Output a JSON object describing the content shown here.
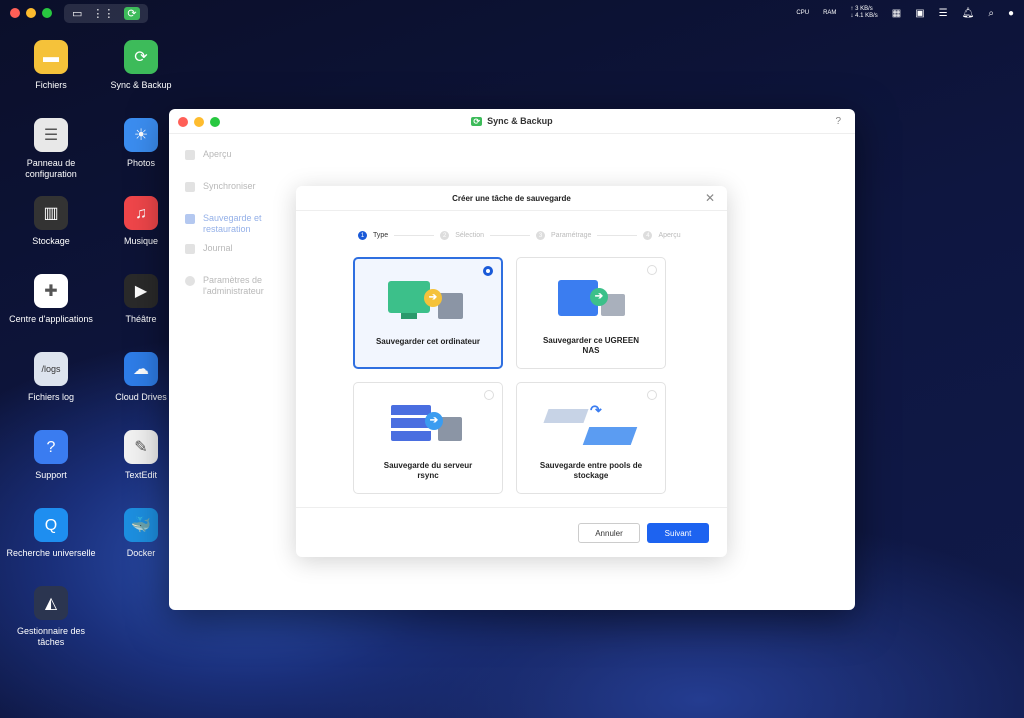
{
  "menubar": {
    "cpu": "CPU",
    "ram": "RAM",
    "upload": "↑ 3 KB/s",
    "download": "↓ 4.1 KB/s"
  },
  "desktop": [
    {
      "label": "Fichiers",
      "color": "#f5c23a",
      "glyph": "▬"
    },
    {
      "label": "Sync & Backup",
      "color": "#3dbb5a",
      "glyph": "⟳"
    },
    {
      "label": "Panneau de configuration",
      "color": "#e8e8e8",
      "glyph": "☰"
    },
    {
      "label": "Photos",
      "color": "#3b8df0",
      "glyph": "☀"
    },
    {
      "label": "Stockage",
      "color": "#333",
      "glyph": "▥"
    },
    {
      "label": "Musique",
      "color": "#f0464a",
      "glyph": "♫"
    },
    {
      "label": "Centre d'applications",
      "color": "#fff",
      "glyph": "✚"
    },
    {
      "label": "Théâtre",
      "color": "#2a2a2a",
      "glyph": "▶"
    },
    {
      "label": "Fichiers log",
      "color": "#dde4ee",
      "glyph": "/logs"
    },
    {
      "label": "Cloud Drives",
      "color": "#2e7de8",
      "glyph": "☁"
    },
    {
      "label": "Support",
      "color": "#3a7cf0",
      "glyph": "?"
    },
    {
      "label": "TextEdit",
      "color": "#f2f2f2",
      "glyph": "✎"
    },
    {
      "label": "Recherche universelle",
      "color": "#1e8ef0",
      "glyph": "Q"
    },
    {
      "label": "Docker",
      "color": "#1d8fe0",
      "glyph": "🐳"
    },
    {
      "label": "Gestionnaire des tâches",
      "color": "#2b3550",
      "glyph": "◭"
    }
  ],
  "window": {
    "title": "Sync & Backup",
    "help": "?",
    "sidebar": [
      "Aperçu",
      "Synchroniser",
      "Sauvegarde et restauration",
      "Journal",
      "Paramètres de l'administrateur"
    ]
  },
  "dialog": {
    "title": "Créer une tâche de sauvegarde",
    "close": "✕",
    "steps": [
      {
        "n": "1",
        "label": "Type"
      },
      {
        "n": "2",
        "label": "Sélection"
      },
      {
        "n": "3",
        "label": "Paramétrage"
      },
      {
        "n": "4",
        "label": "Aperçu"
      }
    ],
    "options": [
      "Sauvegarder cet ordinateur",
      "Sauvegarder ce UGREEN NAS",
      "Sauvegarde du serveur rsync",
      "Sauvegarde entre pools de stockage"
    ],
    "cancel": "Annuler",
    "next": "Suivant"
  }
}
